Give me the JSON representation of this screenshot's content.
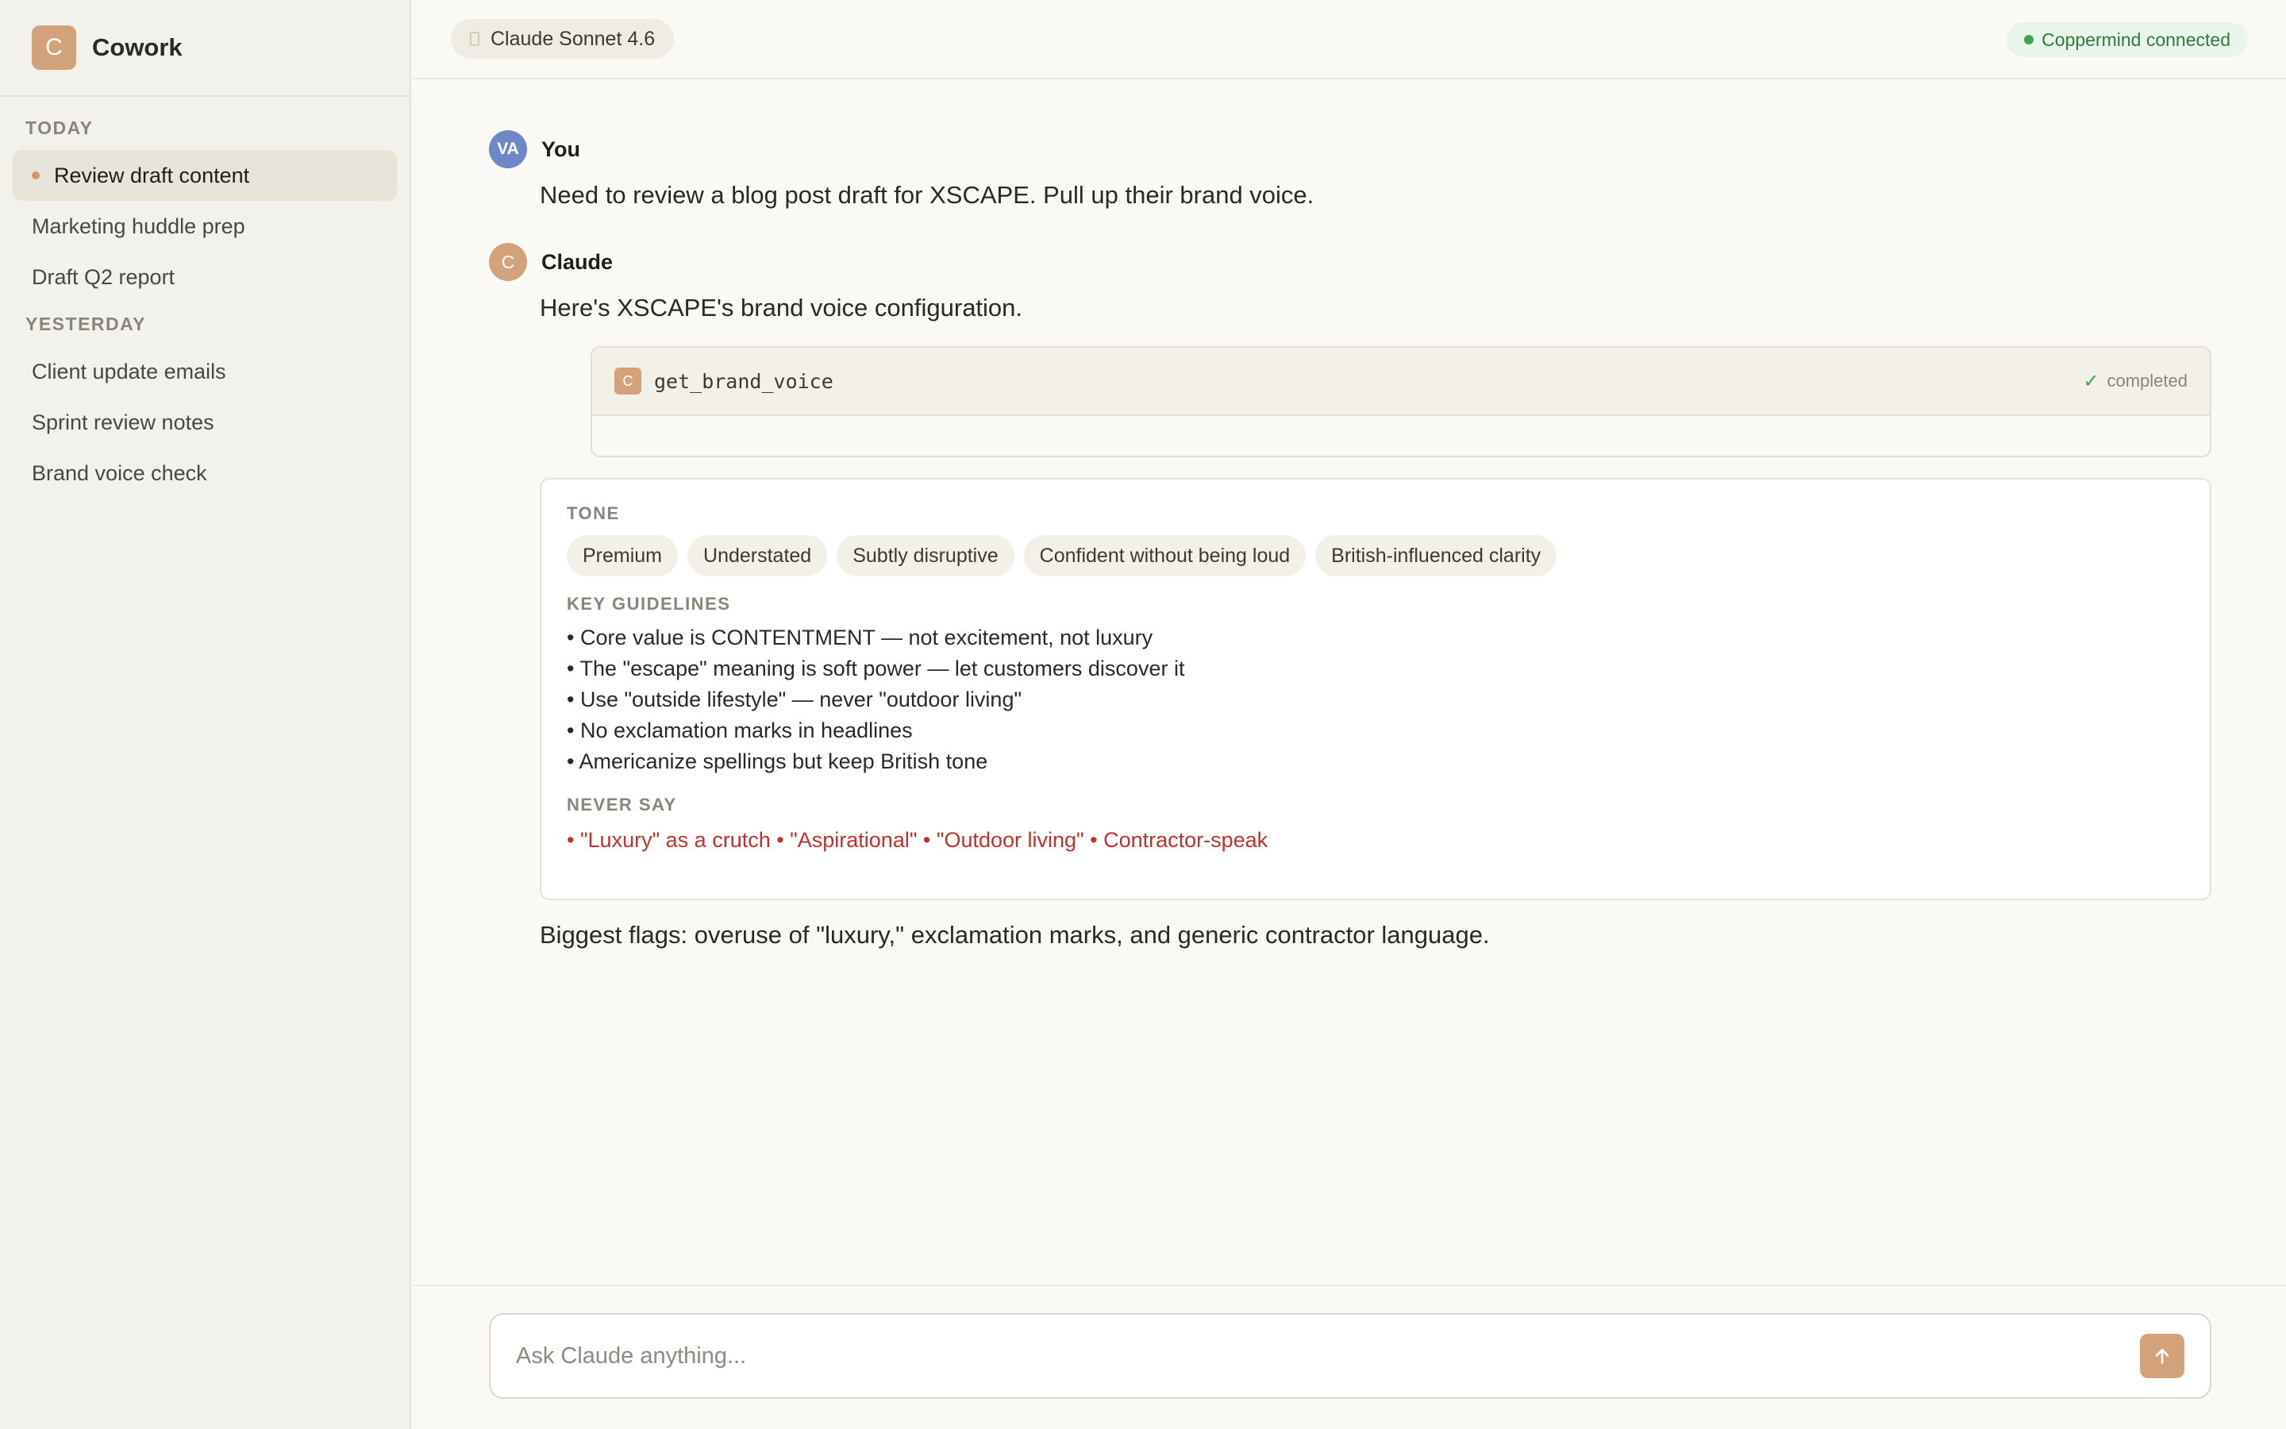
{
  "sidebar": {
    "brand_initial": "C",
    "brand_name": "Cowork",
    "today_label": "TODAY",
    "yesterday_label": "YESTERDAY",
    "today_items": [
      {
        "label": "Review draft content",
        "active": true
      },
      {
        "label": "Marketing huddle prep"
      },
      {
        "label": "Draft Q2 report"
      }
    ],
    "yesterday_items": [
      {
        "label": "Client update emails"
      },
      {
        "label": "Sprint review notes"
      },
      {
        "label": "Brand voice check"
      }
    ]
  },
  "topbar": {
    "model_label": "Claude Sonnet 4.6",
    "status_label": "Coppermind connected"
  },
  "thread": {
    "user": {
      "initials": "VA",
      "name": "You",
      "text": "Need to review a blog post draft for XSCAPE. Pull up their brand voice."
    },
    "claude": {
      "initial": "C",
      "name": "Claude",
      "intro": "Here's XSCAPE's brand voice configuration.",
      "tool": {
        "icon_initial": "C",
        "name": "get_brand_voice",
        "status": "completed"
      },
      "voice": {
        "tone_label": "TONE",
        "tones": [
          "Premium",
          "Understated",
          "Subtly disruptive",
          "Confident without being loud",
          "British-influenced clarity"
        ],
        "guidelines_label": "KEY GUIDELINES",
        "guidelines": [
          "• Core value is CONTENTMENT — not excitement, not luxury",
          "• The \"escape\" meaning is soft power — let customers discover it",
          "• Use \"outside lifestyle\" — never \"outdoor living\"",
          "• No exclamation marks in headlines",
          "• Americanize spellings but keep British tone"
        ],
        "never_label": "NEVER SAY",
        "never_say": "• \"Luxury\" as a crutch • \"Aspirational\" • \"Outdoor living\" • Contractor-speak"
      },
      "closing": "Biggest flags: overuse of \"luxury,\" exclamation marks, and generic contractor language."
    }
  },
  "composer": {
    "placeholder": "Ask Claude anything...",
    "send_icon": "arrow-up-icon"
  },
  "colors": {
    "accent": "#d4a27a",
    "user_avatar": "#6f86c9",
    "status_green": "#3aa655",
    "never_red": "#c0322b"
  }
}
